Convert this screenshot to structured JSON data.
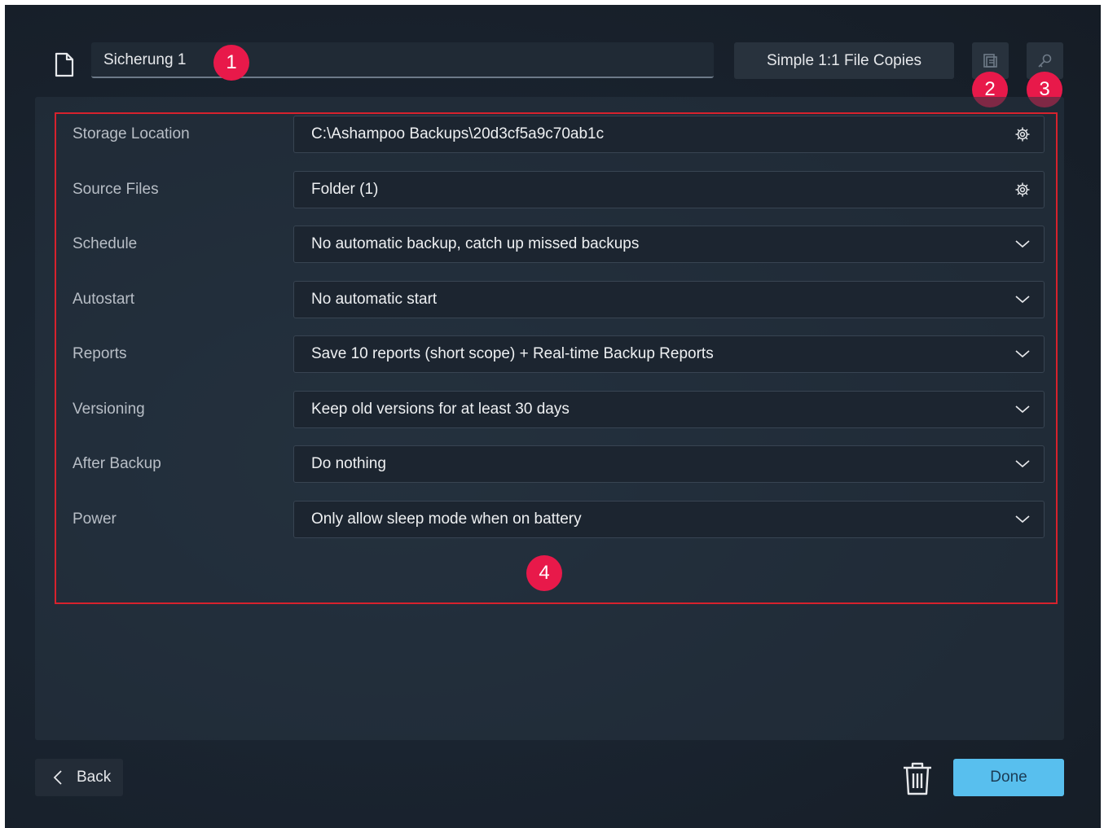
{
  "header": {
    "backup_name": "Sicherung 1",
    "mode_label": "Simple 1:1 File Copies"
  },
  "badges": [
    "1",
    "2",
    "3",
    "4"
  ],
  "settings": [
    {
      "label": "Storage Location",
      "value": "C:\\Ashampoo Backups\\20d3cf5a9c70ab1c",
      "control": "gear-icon"
    },
    {
      "label": "Source Files",
      "value": "Folder (1)",
      "control": "gear-icon"
    },
    {
      "label": "Schedule",
      "value": "No automatic backup, catch up missed backups",
      "control": "chevron-down-icon"
    },
    {
      "label": "Autostart",
      "value": "No automatic start",
      "control": "chevron-down-icon"
    },
    {
      "label": "Reports",
      "value": "Save 10 reports (short scope) + Real-time Backup Reports",
      "control": "chevron-down-icon"
    },
    {
      "label": "Versioning",
      "value": "Keep old versions for at least 30 days",
      "control": "chevron-down-icon"
    },
    {
      "label": "After Backup",
      "value": "Do nothing",
      "control": "chevron-down-icon"
    },
    {
      "label": "Power",
      "value": "Only allow sleep mode when on battery",
      "control": "chevron-down-icon"
    }
  ],
  "footer": {
    "back_label": "Back",
    "done_label": "Done"
  },
  "colors": {
    "accent": "#58bfee",
    "badge": "#e8194a",
    "highlight_border": "#d7222d"
  }
}
